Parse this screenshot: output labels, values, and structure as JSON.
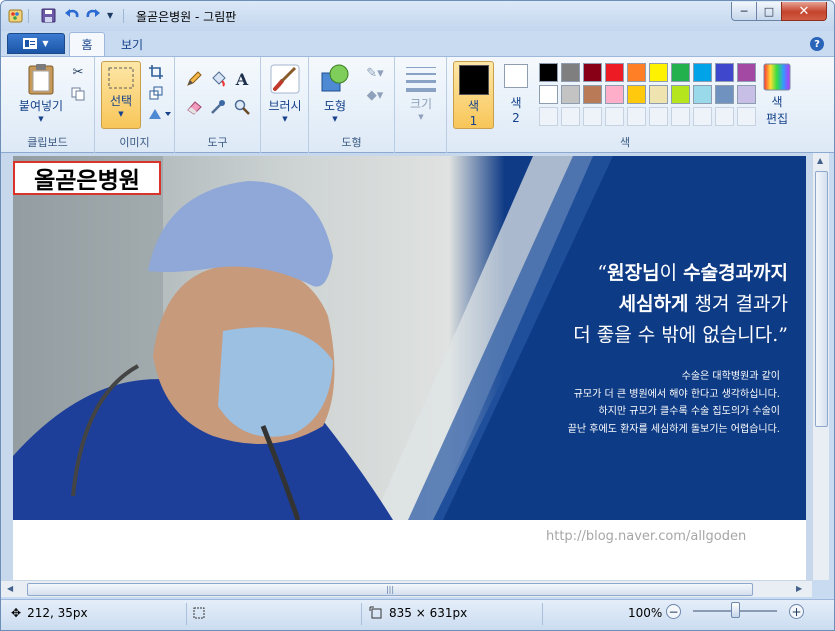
{
  "window": {
    "title": "올곧은병원 - 그림판",
    "controls": {
      "minimize": "─",
      "maximize": "□",
      "close": "✕"
    }
  },
  "tabs": [
    {
      "label": "홈",
      "active": true
    },
    {
      "label": "보기",
      "active": false
    }
  ],
  "help_label": "?",
  "ribbon": {
    "clipboard": {
      "paste_label": "붙여넣기",
      "group_label": "클립보드"
    },
    "image": {
      "select_label": "선택",
      "group_label": "이미지"
    },
    "tools": {
      "group_label": "도구"
    },
    "brushes": {
      "label": "브러시"
    },
    "shapes": {
      "label": "도형",
      "group_label": "도형"
    },
    "size": {
      "label": "크기"
    },
    "color1": {
      "label_line1": "색",
      "label_line2": "1",
      "value": "#000000"
    },
    "color2": {
      "label_line1": "색",
      "label_line2": "2",
      "value": "#ffffff"
    },
    "edit_colors": {
      "label_line1": "색",
      "label_line2": "편집"
    },
    "colors_group_label": "색",
    "palette_row1": [
      "#000000",
      "#7f7f7f",
      "#880015",
      "#ed1c24",
      "#ff7f27",
      "#fff200",
      "#22b14c",
      "#00a2e8",
      "#3f48cc",
      "#a349a4"
    ],
    "palette_row2": [
      "#ffffff",
      "#c3c3c3",
      "#b97a57",
      "#ffaec9",
      "#ffc90e",
      "#efe4b0",
      "#b5e61d",
      "#99d9ea",
      "#7092be",
      "#c8bfe7"
    ]
  },
  "canvas": {
    "hospital_name": "올곧은병원",
    "quote": {
      "open": "“",
      "line1_bold1": "원장님",
      "line1_mid": "이 ",
      "line1_bold2": "수술경과까지",
      "line2_bold": "세심하게",
      "line2_rest": " 챙겨 결과가",
      "line3": "더 좋을 수 밖에 없습니다.",
      "close": "”"
    },
    "body": [
      "수술은 대학병원과 같이",
      "규모가 더 큰 병원에서 해야 한다고 생각하십니다.",
      "하지만 규모가 클수록 수술 집도의가 수술이",
      "끝난 후에도 환자를 세심하게 돌보기는 어렵습니다."
    ],
    "url": "http://blog.naver.com/allgoden"
  },
  "status": {
    "cursor_pos": "212, 35px",
    "image_size": "835 × 631px",
    "zoom": "100%"
  },
  "colors": {
    "accent": "#1c55a6",
    "selection": "#f8c659",
    "status_bg": "#dbe7f6"
  }
}
